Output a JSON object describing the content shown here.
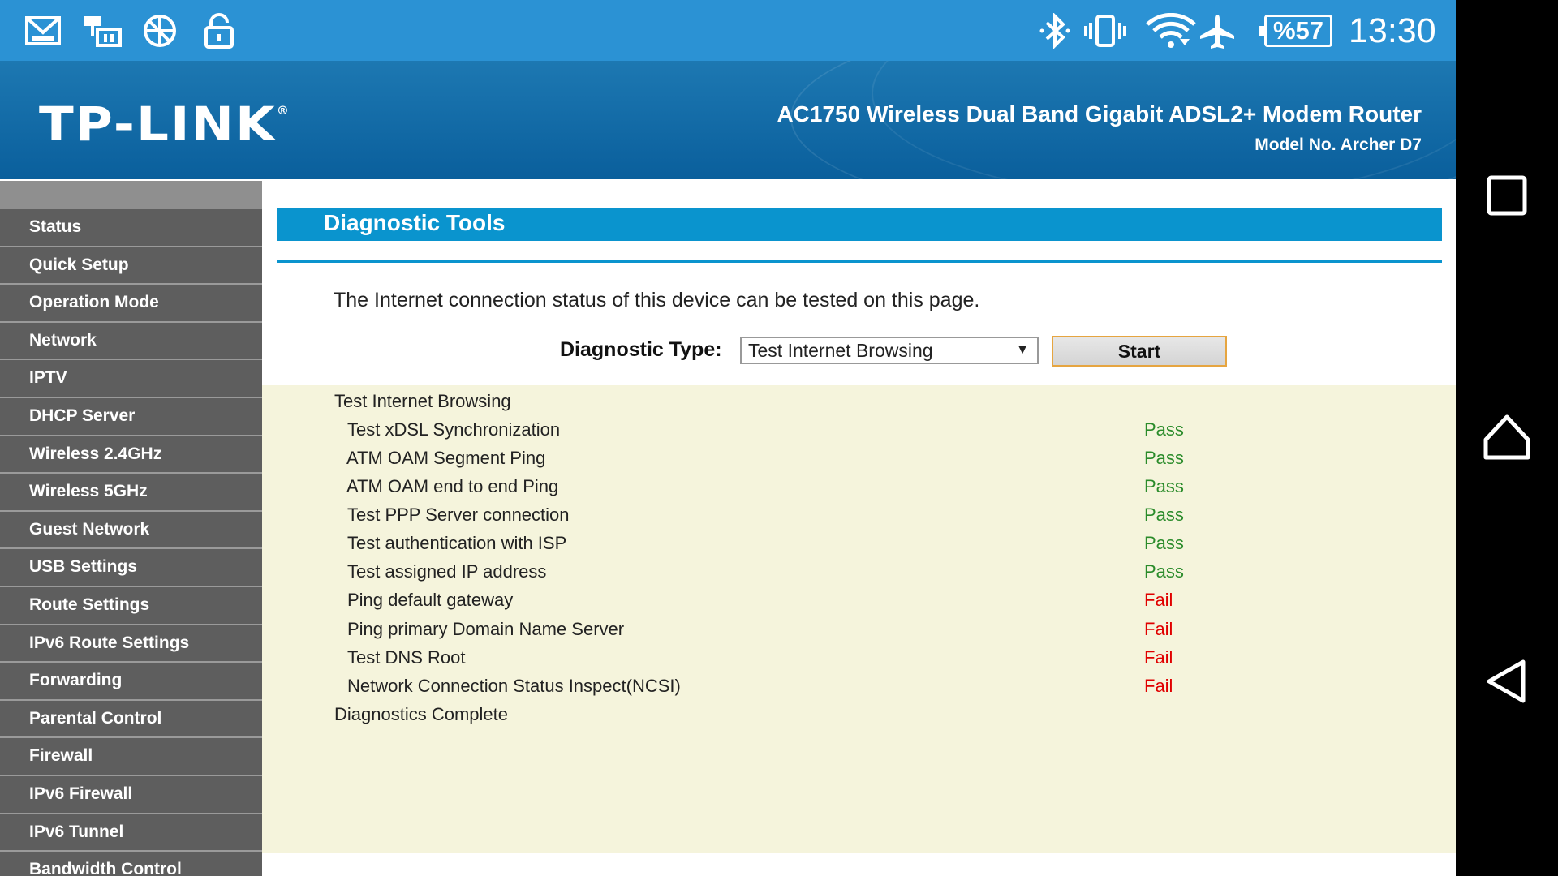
{
  "status_bar": {
    "icons": [
      "mail-icon",
      "remote-icon",
      "no-network-icon",
      "unlock-icon",
      "bluetooth-icon",
      "vibrate-icon",
      "wifi-icon",
      "airplane-icon"
    ],
    "battery": "%57",
    "time": "13:30",
    "color": "#2b92d4"
  },
  "header": {
    "logo": "TP-LINK",
    "product": "AC1750 Wireless Dual Band Gigabit ADSL2+ Modem Router",
    "model": "Model No. Archer D7"
  },
  "sidebar": {
    "items": [
      {
        "label": "Status"
      },
      {
        "label": "Quick Setup"
      },
      {
        "label": "Operation Mode"
      },
      {
        "label": "Network"
      },
      {
        "label": "IPTV"
      },
      {
        "label": "DHCP Server"
      },
      {
        "label": "Wireless 2.4GHz"
      },
      {
        "label": "Wireless 5GHz"
      },
      {
        "label": "Guest Network"
      },
      {
        "label": "USB Settings"
      },
      {
        "label": "Route Settings"
      },
      {
        "label": "IPv6 Route Settings"
      },
      {
        "label": "Forwarding"
      },
      {
        "label": "Parental Control"
      },
      {
        "label": "Firewall"
      },
      {
        "label": "IPv6 Firewall"
      },
      {
        "label": "IPv6 Tunnel"
      },
      {
        "label": "Bandwidth Control"
      }
    ]
  },
  "main": {
    "title": "Diagnostic Tools",
    "intro": "The Internet connection status of this device can be tested on this page.",
    "diag_label": "Diagnostic Type:",
    "diag_selected": "Test Internet Browsing",
    "start_label": "Start",
    "results": {
      "heading": "Test Internet Browsing",
      "tests": [
        {
          "name": "Test xDSL Synchronization",
          "status": "Pass"
        },
        {
          "name": "ATM OAM Segment Ping",
          "status": "Pass"
        },
        {
          "name": "ATM OAM end to end Ping",
          "status": "Pass"
        },
        {
          "name": "Test PPP Server connection",
          "status": "Pass"
        },
        {
          "name": "Test authentication with ISP",
          "status": "Pass"
        },
        {
          "name": "Test assigned IP address",
          "status": "Pass"
        },
        {
          "name": "Ping default gateway",
          "status": "Fail"
        },
        {
          "name": "Ping primary Domain Name Server",
          "status": "Fail"
        },
        {
          "name": "Test DNS Root",
          "status": "Fail"
        },
        {
          "name": "Network Connection Status Inspect(NCSI)",
          "status": "Fail"
        }
      ],
      "footer": "Diagnostics Complete"
    },
    "colors": {
      "accent": "#0a94ce",
      "pass": "#2a8b2a",
      "fail": "#e00000",
      "result_bg": "#f5f4dc"
    }
  },
  "nav_bar": {
    "buttons": [
      "recents-icon",
      "home-icon",
      "back-icon"
    ]
  }
}
